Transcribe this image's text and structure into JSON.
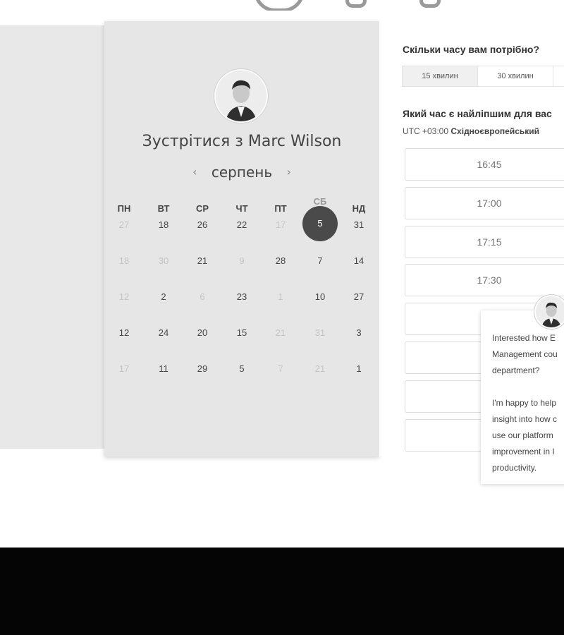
{
  "profile": {
    "meet_title": "Зустрітися з Marc Wilson"
  },
  "calendar": {
    "month": "серпень",
    "prev_icon": "chevron-left-icon",
    "next_icon": "chevron-right-icon",
    "weekdays": [
      "ПН",
      "ВТ",
      "СР",
      "ЧТ",
      "ПТ",
      "СБ",
      "НД"
    ],
    "weeks": [
      [
        "27",
        "18",
        "26",
        "22",
        "17",
        "5",
        "31"
      ],
      [
        "18",
        "30",
        "21",
        "9",
        "28",
        "7",
        "14"
      ],
      [
        "12",
        "2",
        "6",
        "23",
        "1",
        "10",
        "27"
      ],
      [
        "12",
        "24",
        "20",
        "15",
        "21",
        "31",
        "3"
      ],
      [
        "17",
        "11",
        "29",
        "5",
        "7",
        "21",
        "1"
      ]
    ],
    "selected_day": "5"
  },
  "booking": {
    "duration_question": "Скільки часу вам потрібно?",
    "durations": [
      "15 хвилин",
      "30 хвилин"
    ],
    "selected_duration": "15 хвилин",
    "time_question": "Який час є найліпшим для вас",
    "timezone_prefix": "UTC +03:00",
    "timezone_name": "Східноєвропейський",
    "slots": [
      "16:45",
      "17:00",
      "17:15",
      "17:30",
      "",
      "",
      ""
    ]
  },
  "chat": {
    "message": "Interested how E\nManagement cou\ndepartment?\n\nI'm happy to help\ninsight into how c\nuse our platform\nimprovement in I\nproductivity."
  }
}
